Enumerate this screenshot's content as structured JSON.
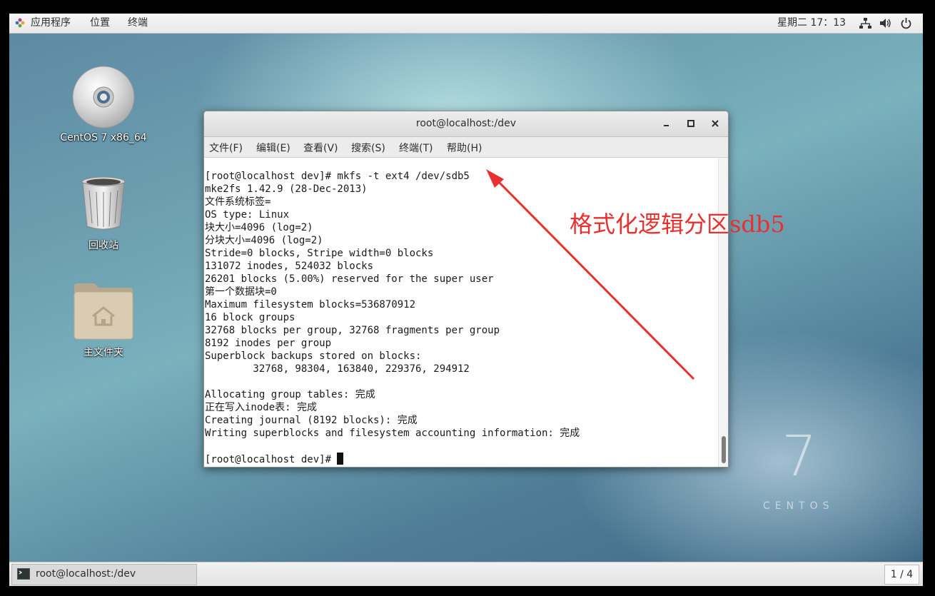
{
  "top_panel": {
    "menu": [
      "应用程序",
      "位置",
      "终端"
    ],
    "clock": "星期二 17：13"
  },
  "desktop": {
    "icons": [
      {
        "label": "CentOS 7 x86_64",
        "icon": "dvd-disc-icon"
      },
      {
        "label": "回收站",
        "icon": "trash-icon"
      },
      {
        "label": "主文件夹",
        "icon": "home-folder-icon"
      }
    ],
    "watermark_number": "7",
    "watermark_text": "CENTOS"
  },
  "window": {
    "title": "root@localhost:/dev",
    "menu": [
      "文件(F)",
      "编辑(E)",
      "查看(V)",
      "搜索(S)",
      "终端(T)",
      "帮助(H)"
    ]
  },
  "terminal": {
    "lines": [
      "[root@localhost dev]# mkfs -t ext4 /dev/sdb5",
      "mke2fs 1.42.9 (28-Dec-2013)",
      "文件系统标签=",
      "OS type: Linux",
      "块大小=4096 (log=2)",
      "分块大小=4096 (log=2)",
      "Stride=0 blocks, Stripe width=0 blocks",
      "131072 inodes, 524032 blocks",
      "26201 blocks (5.00%) reserved for the super user",
      "第一个数据块=0",
      "Maximum filesystem blocks=536870912",
      "16 block groups",
      "32768 blocks per group, 32768 fragments per group",
      "8192 inodes per group",
      "Superblock backups stored on blocks:",
      "        32768, 98304, 163840, 229376, 294912",
      "",
      "Allocating group tables: 完成",
      "正在写入inode表: 完成",
      "Creating journal (8192 blocks): 完成",
      "Writing superblocks and filesystem accounting information: 完成",
      "",
      "[root@localhost dev]# "
    ]
  },
  "annotation": {
    "text": "格式化逻辑分区sdb5",
    "color": "#e8302f"
  },
  "bottom_panel": {
    "task": "root@localhost:/dev",
    "workspace": "1 / 4"
  }
}
